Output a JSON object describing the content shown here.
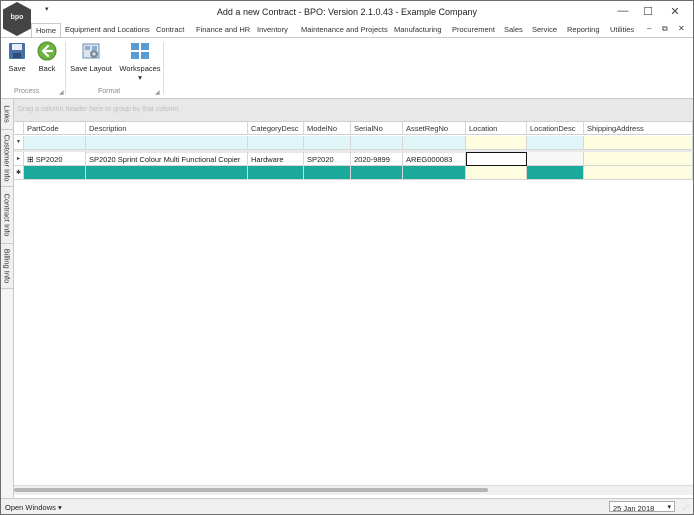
{
  "window": {
    "title": "Add a new Contract - BPO: Version 2.1.0.43 - Example Company",
    "logo_text": "bpo",
    "qat_arrow": "▾",
    "controls": {
      "minimize": "—",
      "maximize": "☐",
      "close": "✕"
    }
  },
  "ribbon_tabs": [
    "Home",
    "Equipment and Locations",
    "Contract",
    "Finance and HR",
    "Inventory",
    "Maintenance and Projects",
    "Manufacturing",
    "Procurement",
    "Sales",
    "Service",
    "Reporting",
    "Utilities"
  ],
  "mdi_controls": {
    "minimize": "–",
    "restore": "⧉",
    "close": "✕"
  },
  "ribbon": {
    "buttons": {
      "save": "Save",
      "back": "Back",
      "save_layout": "Save Layout",
      "workspaces": "Workspaces"
    },
    "workspaces_arrow": "▾",
    "groups": {
      "process": "Process",
      "format": "Format"
    },
    "launcher": "◢"
  },
  "side_tabs": [
    "Links",
    "Customer Info",
    "Contract Info",
    "Billing Info"
  ],
  "grid": {
    "group_hint": "Drag a column header here to group by that column",
    "columns": [
      "PartCode",
      "Description",
      "CategoryDesc",
      "ModelNo",
      "SerialNo",
      "AssetRegNo",
      "Location",
      "LocationDesc",
      "ShippingAddress"
    ],
    "filter_icon": "▼",
    "rows": [
      {
        "expander": "⊞",
        "indicator": "▸",
        "cells": [
          "SP2020",
          "SP2020 Sprint Colour Multi Functional Copier",
          "Hardware",
          "SP2020",
          "2020-9899",
          "AREG000083",
          "",
          "",
          ""
        ]
      }
    ],
    "new_row_indicator": "✱"
  },
  "status_bar": {
    "open_windows": "Open Windows ▾",
    "date": "25 Jan 2018",
    "calendar_arrow": "▾"
  },
  "colors": {
    "new_row_teal": "#1aa99a",
    "filter_row": "#dff5f7",
    "location_yellow": "#fffde0"
  }
}
